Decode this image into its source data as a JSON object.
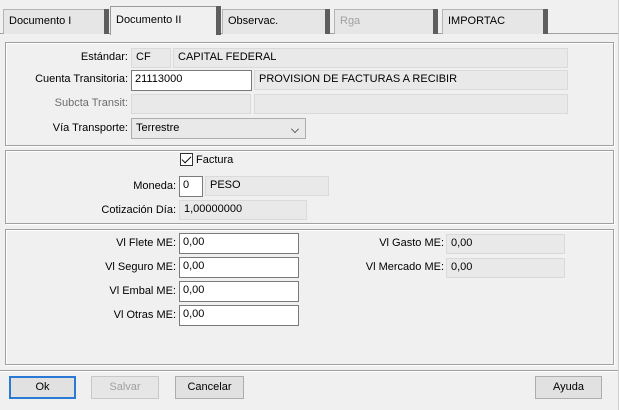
{
  "tabs": [
    {
      "label": "Documento  I"
    },
    {
      "label": "Documento II"
    },
    {
      "label": "Observac."
    },
    {
      "label": "Rga"
    },
    {
      "label": "IMPORTAC"
    }
  ],
  "transport": {
    "estandar_label": "Estándar:",
    "estandar_code": "CF",
    "estandar_desc": "CAPITAL FEDERAL",
    "cuenta_label": "Cuenta Transitoria:",
    "cuenta_value": "21113000",
    "cuenta_desc": "PROVISION DE FACTURAS A  RECIBIR",
    "subcta_label": "Subcta Transit:",
    "subcta_value": "",
    "subcta_desc": "",
    "via_label": "Vía Transporte:",
    "via_value": "Terrestre"
  },
  "invoice": {
    "factura_label": "Factura",
    "factura_checked": true,
    "moneda_label": "Moneda:",
    "moneda_code": "0",
    "moneda_desc": "PESO",
    "cotizacion_label": "Cotización Día:",
    "cotizacion_value": "1,00000000"
  },
  "costs": {
    "flete_label": "Vl Flete ME:",
    "flete_value": "0,00",
    "seguro_label": "Vl Seguro ME:",
    "seguro_value": "0,00",
    "embal_label": "Vl Embal ME:",
    "embal_value": "0,00",
    "otras_label": "Vl Otras ME:",
    "otras_value": "0,00",
    "gasto_label": "Vl Gasto ME:",
    "gasto_value": "0,00",
    "mercado_label": "Vl Mercado ME:",
    "mercado_value": "0,00"
  },
  "buttons": {
    "ok": "Ok",
    "salvar": "Salvar",
    "cancelar": "Cancelar",
    "ayuda": "Ayuda"
  }
}
